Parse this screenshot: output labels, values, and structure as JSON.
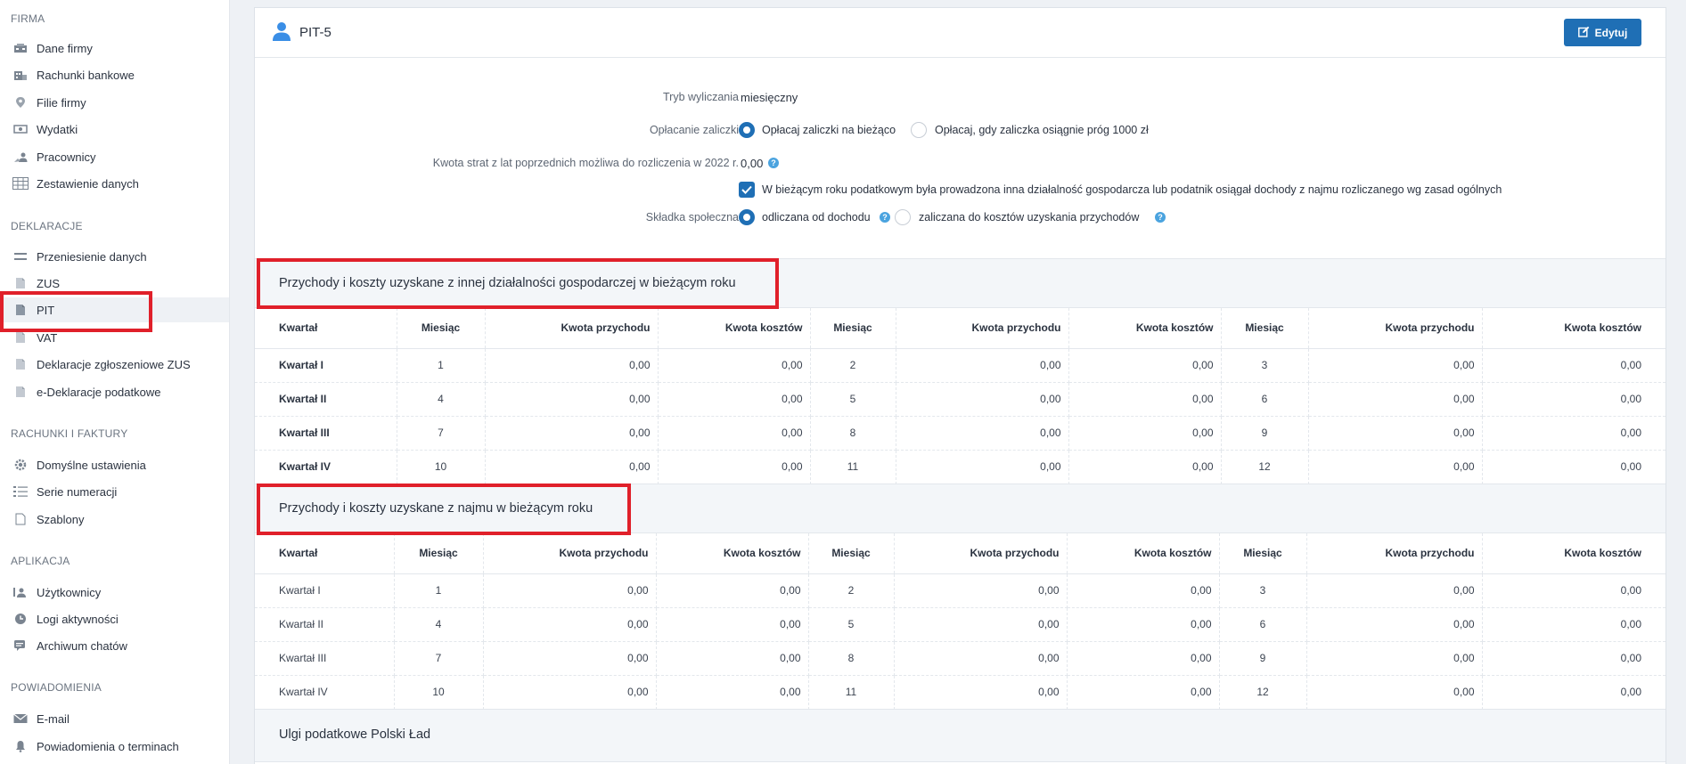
{
  "sidebar": {
    "sections": [
      {
        "title": "FIRMA",
        "items": [
          {
            "label": "Dane firmy",
            "icon": "building-icon"
          },
          {
            "label": "Rachunki bankowe",
            "icon": "bank-icon"
          },
          {
            "label": "Filie firmy",
            "icon": "map-pin-icon"
          },
          {
            "label": "Wydatki",
            "icon": "expenses-icon"
          },
          {
            "label": "Pracownicy",
            "icon": "users-icon"
          },
          {
            "label": "Zestawienie danych",
            "icon": "table-icon"
          }
        ]
      },
      {
        "title": "DEKLARACJE",
        "items": [
          {
            "label": "Przeniesienie danych",
            "icon": "transfer-icon"
          },
          {
            "label": "ZUS",
            "icon": "document-icon"
          },
          {
            "label": "PIT",
            "icon": "document-icon"
          },
          {
            "label": "VAT",
            "icon": "document-icon"
          },
          {
            "label": "Deklaracje zgłoszeniowe ZUS",
            "icon": "document-icon"
          },
          {
            "label": "e-Deklaracje podatkowe",
            "icon": "document-icon"
          }
        ]
      },
      {
        "title": "RACHUNKI I FAKTURY",
        "items": [
          {
            "label": "Domyślne ustawienia",
            "icon": "gear-icon"
          },
          {
            "label": "Serie numeracji",
            "icon": "numbered-list-icon"
          },
          {
            "label": "Szablony",
            "icon": "document-icon"
          }
        ]
      },
      {
        "title": "APLIKACJA",
        "items": [
          {
            "label": "Użytkownicy",
            "icon": "user-list-icon"
          },
          {
            "label": "Logi aktywności",
            "icon": "clock-icon"
          },
          {
            "label": "Archiwum chatów",
            "icon": "chat-icon"
          }
        ]
      },
      {
        "title": "POWIADOMIENIA",
        "items": [
          {
            "label": "E-mail",
            "icon": "mail-icon"
          },
          {
            "label": "Powiadomienia o terminach",
            "icon": "bell-icon"
          }
        ]
      }
    ],
    "active": "PIT"
  },
  "header": {
    "title": "PIT-5",
    "edit_label": "Edytuj"
  },
  "form": {
    "tryb_label": "Tryb wyliczania",
    "tryb_value": "miesięczny",
    "oplacanie_label": "Opłacanie zaliczki",
    "oplacanie_opt1": "Opłacaj zaliczki na bieżąco",
    "oplacanie_opt2": "Opłacaj, gdy zaliczka osiągnie próg 1000 zł",
    "straty_label": "Kwota strat z lat poprzednich możliwa do rozliczenia w 2022 r.",
    "straty_value": "0,00",
    "checkbox_label": "W bieżącym roku podatkowym była prowadzona inna działalność gospodarcza lub podatnik osiągał dochody z najmu rozliczanego wg zasad ogólnych",
    "skladka_label": "Składka społeczna",
    "skladka_opt1": "odliczana od dochodu",
    "skladka_opt2": "zaliczana do kosztów uzyskania przychodów"
  },
  "table1": {
    "title": "Przychody i koszty uzyskane z innej działalności gospodarczej w bieżącym roku",
    "headers": [
      "Kwartał",
      "Miesiąc",
      "Kwota przychodu",
      "Kwota kosztów",
      "Miesiąc",
      "Kwota przychodu",
      "Kwota kosztów",
      "Miesiąc",
      "Kwota przychodu",
      "Kwota kosztów"
    ],
    "rows": [
      [
        "Kwartał I",
        "1",
        "0,00",
        "0,00",
        "2",
        "0,00",
        "0,00",
        "3",
        "0,00",
        "0,00"
      ],
      [
        "Kwartał II",
        "4",
        "0,00",
        "0,00",
        "5",
        "0,00",
        "0,00",
        "6",
        "0,00",
        "0,00"
      ],
      [
        "Kwartał III",
        "7",
        "0,00",
        "0,00",
        "8",
        "0,00",
        "0,00",
        "9",
        "0,00",
        "0,00"
      ],
      [
        "Kwartał IV",
        "10",
        "0,00",
        "0,00",
        "11",
        "0,00",
        "0,00",
        "12",
        "0,00",
        "0,00"
      ]
    ]
  },
  "table2": {
    "title": "Przychody i koszty uzyskane z najmu w bieżącym roku",
    "headers": [
      "Kwartał",
      "Miesiąc",
      "Kwota przychodu",
      "Kwota kosztów",
      "Miesiąc",
      "Kwota przychodu",
      "Kwota kosztów",
      "Miesiąc",
      "Kwota przychodu",
      "Kwota kosztów"
    ],
    "rows": [
      [
        "Kwartał I",
        "1",
        "0,00",
        "0,00",
        "2",
        "0,00",
        "0,00",
        "3",
        "0,00",
        "0,00"
      ],
      [
        "Kwartał II",
        "4",
        "0,00",
        "0,00",
        "5",
        "0,00",
        "0,00",
        "6",
        "0,00",
        "0,00"
      ],
      [
        "Kwartał III",
        "7",
        "0,00",
        "0,00",
        "8",
        "0,00",
        "0,00",
        "9",
        "0,00",
        "0,00"
      ],
      [
        "Kwartał IV",
        "10",
        "0,00",
        "0,00",
        "11",
        "0,00",
        "0,00",
        "12",
        "0,00",
        "0,00"
      ]
    ]
  },
  "section3": {
    "title": "Ulgi podatkowe Polski Ład"
  },
  "colors": {
    "accent": "#1f6fb5",
    "highlight": "#e0202a"
  }
}
